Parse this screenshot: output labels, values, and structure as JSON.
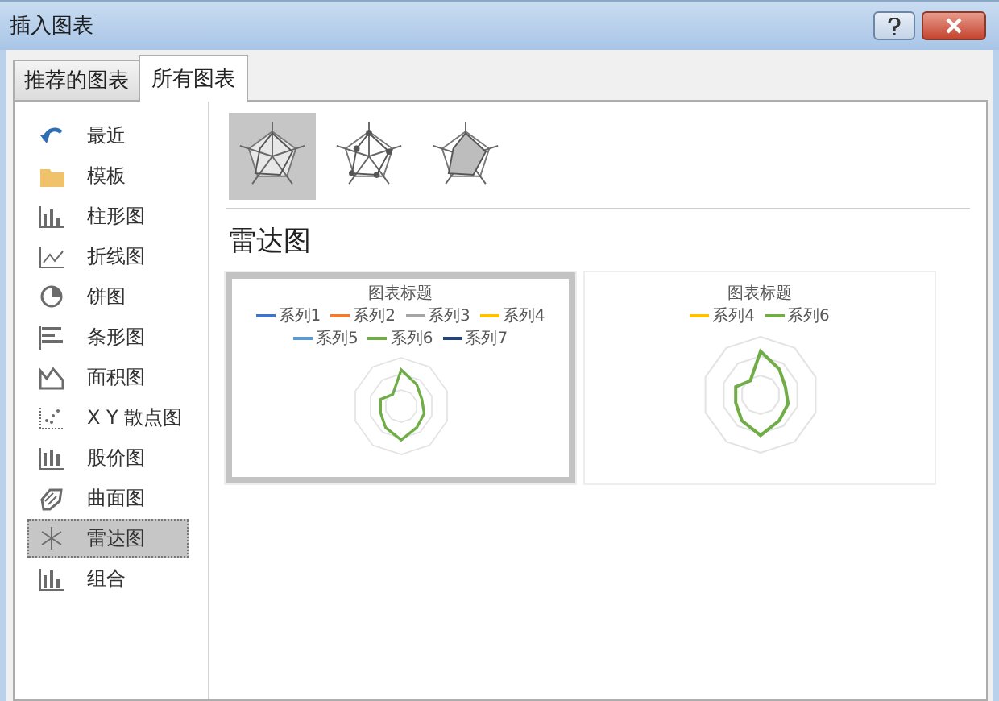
{
  "window": {
    "title": "插入图表"
  },
  "tabs": [
    {
      "label": "推荐的图表",
      "selected": false
    },
    {
      "label": "所有图表",
      "selected": true
    }
  ],
  "categories": [
    {
      "label": "最近",
      "selected": false
    },
    {
      "label": "模板",
      "selected": false
    },
    {
      "label": "柱形图",
      "selected": false
    },
    {
      "label": "折线图",
      "selected": false
    },
    {
      "label": "饼图",
      "selected": false
    },
    {
      "label": "条形图",
      "selected": false
    },
    {
      "label": "面积图",
      "selected": false
    },
    {
      "label": "X Y 散点图",
      "selected": false
    },
    {
      "label": "股价图",
      "selected": false
    },
    {
      "label": "曲面图",
      "selected": false
    },
    {
      "label": "雷达图",
      "selected": true
    },
    {
      "label": "组合",
      "selected": false
    }
  ],
  "subtypes": [
    {
      "selected": true
    },
    {
      "selected": false
    },
    {
      "selected": false
    }
  ],
  "section_title": "雷达图",
  "previews": [
    {
      "title": "图表标题",
      "selected": true,
      "legend": [
        {
          "label": "系列1",
          "color": "#4472c4"
        },
        {
          "label": "系列2",
          "color": "#ed7d31"
        },
        {
          "label": "系列3",
          "color": "#a5a5a5"
        },
        {
          "label": "系列4",
          "color": "#ffc000"
        },
        {
          "label": "系列5",
          "color": "#5b9bd5"
        },
        {
          "label": "系列6",
          "color": "#70ad47"
        },
        {
          "label": "系列7",
          "color": "#264478"
        }
      ]
    },
    {
      "title": "图表标题",
      "selected": false,
      "legend": [
        {
          "label": "系列4",
          "color": "#ffc000"
        },
        {
          "label": "系列6",
          "color": "#70ad47"
        }
      ]
    }
  ]
}
